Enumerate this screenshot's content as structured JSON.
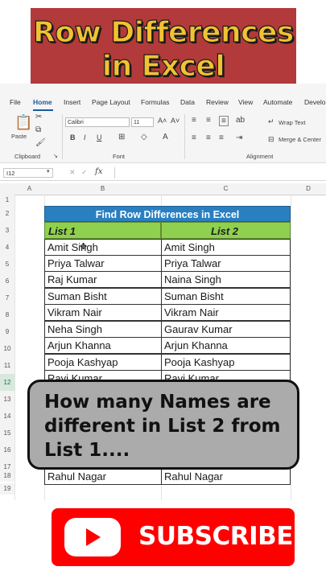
{
  "banner": {
    "line1": "Row Differences",
    "line2": "in Excel"
  },
  "ribbon": {
    "tabs": [
      "File",
      "Home",
      "Insert",
      "Page Layout",
      "Formulas",
      "Data",
      "Review",
      "View",
      "Automate",
      "Develo"
    ],
    "active_tab": "Home",
    "clipboard": {
      "paste_label": "Paste",
      "group_label": "Clipboard"
    },
    "font": {
      "name": "Calibri",
      "size": "11",
      "group_label": "Font",
      "bold": "B",
      "italic": "I",
      "underline": "U"
    },
    "alignment": {
      "wrap_text": "Wrap Text",
      "merge_center": "Merge & Center",
      "group_label": "Alignment"
    }
  },
  "formula_bar": {
    "name_box": "I12",
    "fx": "fx"
  },
  "grid": {
    "columns": [
      "A",
      "B",
      "C",
      "D"
    ],
    "rows": [
      "1",
      "2",
      "3",
      "4",
      "5",
      "6",
      "7",
      "8",
      "9",
      "10",
      "11",
      "12",
      "13",
      "14",
      "15",
      "16",
      "17",
      "18",
      "19"
    ]
  },
  "table": {
    "title": "Find Row Differences in Excel",
    "header1": "List 1",
    "header2": "List 2",
    "rows": [
      [
        "Amit Singh",
        "Amit Singh"
      ],
      [
        "Priya Talwar",
        "Priya Talwar"
      ],
      [
        "Raj Kumar",
        "Naina Singh"
      ],
      [
        "Suman Bisht",
        "Suman Bisht"
      ],
      [
        "Vikram Nair",
        "Vikram Nair"
      ],
      [
        "Neha Singh",
        "Gaurav Kumar"
      ],
      [
        "Arjun Khanna",
        "Arjun Khanna"
      ],
      [
        "Pooja Kashyap",
        "Pooja Kashyap"
      ],
      [
        "Ravi Kumar",
        "Ravi Kumar"
      ],
      [
        "Rahul Nagar",
        "Rahul Nagar"
      ]
    ]
  },
  "overlay": {
    "question": "How many Names are different in List 2  from List 1...."
  },
  "subscribe": {
    "label": "SUBSCRIBE"
  },
  "colors": {
    "banner_bg": "#b33a3a",
    "banner_text": "#f1c232",
    "title_bg": "#2a7fc1",
    "header_bg": "#8fd14f",
    "subscribe_bg": "#ff0000"
  }
}
